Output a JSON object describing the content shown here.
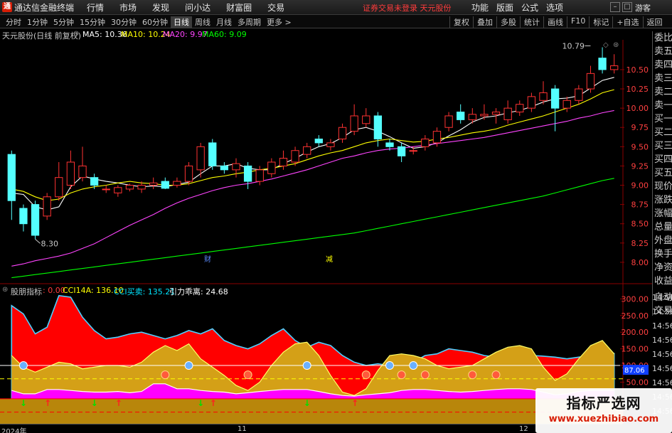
{
  "titlebar": {
    "app_title": "通达信金融终端",
    "menu": [
      "行情",
      "市场",
      "发现",
      "问小达",
      "财富圈",
      "交易"
    ],
    "login_status": "证券交易未登录  天元股份",
    "right_menu": [
      "功能",
      "版面",
      "公式",
      "选项"
    ],
    "guest": "游客"
  },
  "toolbar": {
    "periods": [
      "分时",
      "1分钟",
      "5分钟",
      "15分钟",
      "30分钟",
      "60分钟",
      "日线",
      "周线",
      "月线",
      "多周期",
      "更多 >"
    ],
    "active_period": "日线",
    "tools": [
      "复权",
      "叠加",
      "多股",
      "统计",
      "画线",
      "F10",
      "标记",
      "+自选",
      "返回"
    ]
  },
  "info": {
    "stock": "天元股份(日线 前复权)",
    "ma5": "MA5: 10.36",
    "ma10": "MA10: 10.24",
    "ma20": "MA20: 9.97",
    "ma60": "MA60: 9.09"
  },
  "indicator": {
    "name": "股朋指标",
    "val0": ": 0.00",
    "cci14a": "CCI14A: 136.10",
    "cci_trade": "CCI买卖: 135.21",
    "gravity": "引力乖离: 24.68",
    "current_label": "87.06"
  },
  "sidebar": [
    "委比",
    "卖五",
    "卖四",
    "卖三",
    "卖二",
    "卖一",
    "买一",
    "买二",
    "买三",
    "买四",
    "买五",
    "现价",
    "涨跌",
    "涨幅",
    "总量",
    "外盘",
    "换手",
    "净资",
    "收益"
  ],
  "sidebar_lower": [
    "自动",
    "交易"
  ],
  "time_axis": [
    "14:56",
    "14:56",
    "14:56",
    "14:56",
    "14:56",
    "14:56",
    "14:56",
    "14:56",
    "14:56"
  ],
  "date_axis": [
    "2024年",
    "11",
    "12"
  ],
  "watermark": {
    "title": "指标严选网",
    "url": "www.xuezhibiao.com"
  },
  "chart_data": [
    {
      "type": "candlestick",
      "title": "天元股份(日线 前复权)",
      "y_ticks": [
        10.5,
        10.25,
        10.0,
        9.75,
        9.5,
        9.25,
        9.0,
        8.75,
        8.5,
        8.25,
        8.0
      ],
      "ylim": [
        7.75,
        10.85
      ],
      "markers": [
        {
          "text": "10.79",
          "label": "high"
        },
        {
          "text": "8.30",
          "label": "low"
        },
        {
          "text": "财",
          "label": "event"
        },
        {
          "text": "减",
          "label": "event"
        }
      ],
      "candles": [
        {
          "o": 8.8,
          "c": 9.4,
          "h": 9.45,
          "l": 8.55,
          "up": false
        },
        {
          "o": 8.5,
          "c": 8.7,
          "h": 8.75,
          "l": 8.4,
          "up": false
        },
        {
          "o": 8.75,
          "c": 8.35,
          "h": 8.8,
          "l": 8.3,
          "up": false
        },
        {
          "o": 8.6,
          "c": 8.85,
          "h": 8.9,
          "l": 8.55,
          "up": true
        },
        {
          "o": 8.85,
          "c": 9.1,
          "h": 9.3,
          "l": 8.8,
          "up": true
        },
        {
          "o": 9.0,
          "c": 9.3,
          "h": 9.45,
          "l": 8.95,
          "up": true
        },
        {
          "o": 9.1,
          "c": 9.25,
          "h": 9.5,
          "l": 9.05,
          "up": true
        },
        {
          "o": 9.1,
          "c": 9.0,
          "h": 9.15,
          "l": 8.95,
          "up": false
        },
        {
          "o": 8.95,
          "c": 8.95,
          "h": 9.0,
          "l": 8.9,
          "up": true
        },
        {
          "o": 8.9,
          "c": 8.97,
          "h": 9.0,
          "l": 8.85,
          "up": true
        },
        {
          "o": 8.95,
          "c": 9.0,
          "h": 9.02,
          "l": 8.92,
          "up": true
        },
        {
          "o": 9.0,
          "c": 8.95,
          "h": 9.05,
          "l": 8.9,
          "up": true
        },
        {
          "o": 9.0,
          "c": 9.03,
          "h": 9.1,
          "l": 8.95,
          "up": true
        },
        {
          "o": 9.05,
          "c": 8.96,
          "h": 9.1,
          "l": 8.95,
          "up": false
        },
        {
          "o": 9.0,
          "c": 9.05,
          "h": 9.1,
          "l": 8.97,
          "up": true
        },
        {
          "o": 9.05,
          "c": 9.25,
          "h": 9.3,
          "l": 9.0,
          "up": true
        },
        {
          "o": 9.2,
          "c": 9.5,
          "h": 9.55,
          "l": 9.1,
          "up": true
        },
        {
          "o": 9.55,
          "c": 9.25,
          "h": 9.6,
          "l": 9.2,
          "up": false
        },
        {
          "o": 9.25,
          "c": 9.2,
          "h": 9.3,
          "l": 9.15,
          "up": false
        },
        {
          "o": 9.2,
          "c": 9.28,
          "h": 9.35,
          "l": 9.1,
          "up": true
        },
        {
          "o": 9.25,
          "c": 9.05,
          "h": 9.3,
          "l": 8.95,
          "up": false
        },
        {
          "o": 9.05,
          "c": 9.2,
          "h": 9.25,
          "l": 9.0,
          "up": true
        },
        {
          "o": 9.15,
          "c": 9.3,
          "h": 9.35,
          "l": 9.1,
          "up": true
        },
        {
          "o": 9.25,
          "c": 9.35,
          "h": 9.45,
          "l": 9.2,
          "up": true
        },
        {
          "o": 9.3,
          "c": 9.45,
          "h": 9.5,
          "l": 9.25,
          "up": true
        },
        {
          "o": 9.4,
          "c": 9.5,
          "h": 9.55,
          "l": 9.35,
          "up": true
        },
        {
          "o": 9.55,
          "c": 9.6,
          "h": 9.65,
          "l": 9.5,
          "up": false
        },
        {
          "o": 9.5,
          "c": 9.55,
          "h": 9.6,
          "l": 9.45,
          "up": true
        },
        {
          "o": 9.6,
          "c": 9.75,
          "h": 9.8,
          "l": 9.55,
          "up": true
        },
        {
          "o": 9.7,
          "c": 9.9,
          "h": 10.05,
          "l": 9.65,
          "up": true
        },
        {
          "o": 9.9,
          "c": 9.8,
          "h": 10.0,
          "l": 9.75,
          "up": true
        },
        {
          "o": 9.9,
          "c": 9.6,
          "h": 9.95,
          "l": 9.5,
          "up": false
        },
        {
          "o": 9.55,
          "c": 9.5,
          "h": 9.6,
          "l": 9.45,
          "up": false
        },
        {
          "o": 9.5,
          "c": 9.38,
          "h": 9.55,
          "l": 9.3,
          "up": false
        },
        {
          "o": 9.45,
          "c": 9.45,
          "h": 9.5,
          "l": 9.4,
          "up": true
        },
        {
          "o": 9.5,
          "c": 9.6,
          "h": 9.65,
          "l": 9.45,
          "up": true
        },
        {
          "o": 9.55,
          "c": 9.7,
          "h": 9.75,
          "l": 9.5,
          "up": true
        },
        {
          "o": 9.75,
          "c": 9.9,
          "h": 9.95,
          "l": 9.7,
          "up": true
        },
        {
          "o": 9.95,
          "c": 9.85,
          "h": 10.05,
          "l": 9.8,
          "up": false
        },
        {
          "o": 9.85,
          "c": 9.92,
          "h": 10.0,
          "l": 9.8,
          "up": true
        },
        {
          "o": 9.9,
          "c": 9.92,
          "h": 10.05,
          "l": 9.85,
          "up": true
        },
        {
          "o": 9.95,
          "c": 9.92,
          "h": 10.0,
          "l": 9.8,
          "up": true
        },
        {
          "o": 9.85,
          "c": 10.0,
          "h": 10.1,
          "l": 9.8,
          "up": true
        },
        {
          "o": 9.95,
          "c": 10.05,
          "h": 10.1,
          "l": 9.9,
          "up": true
        },
        {
          "o": 10.0,
          "c": 10.15,
          "h": 10.2,
          "l": 9.95,
          "up": true
        },
        {
          "o": 10.1,
          "c": 10.2,
          "h": 10.35,
          "l": 10.05,
          "up": true
        },
        {
          "o": 10.25,
          "c": 10.0,
          "h": 10.3,
          "l": 9.7,
          "up": false
        },
        {
          "o": 10.0,
          "c": 10.1,
          "h": 10.15,
          "l": 9.95,
          "up": true
        },
        {
          "o": 10.1,
          "c": 10.25,
          "h": 10.3,
          "l": 10.05,
          "up": true
        },
        {
          "o": 10.25,
          "c": 10.45,
          "h": 10.55,
          "l": 10.2,
          "up": true
        },
        {
          "o": 10.65,
          "c": 10.5,
          "h": 10.79,
          "l": 10.45,
          "up": false
        },
        {
          "o": 10.5,
          "c": 10.55,
          "h": 10.7,
          "l": 10.45,
          "up": true
        }
      ],
      "series": [
        {
          "name": "MA5",
          "color": "#ffffff",
          "values": [
            8.9,
            8.88,
            8.72,
            8.68,
            8.72,
            8.98,
            9.12,
            9.08,
            9.05,
            9.03,
            9.0,
            8.98,
            8.99,
            8.98,
            9.01,
            9.04,
            9.15,
            9.25,
            9.25,
            9.28,
            9.22,
            9.2,
            9.2,
            9.28,
            9.35,
            9.43,
            9.5,
            9.54,
            9.62,
            9.72,
            9.75,
            9.7,
            9.63,
            9.55,
            9.48,
            9.5,
            9.55,
            9.64,
            9.72,
            9.82,
            9.88,
            9.9,
            9.94,
            9.97,
            10.02,
            10.08,
            10.12,
            10.13,
            10.16,
            10.26,
            10.36,
            10.4
          ]
        },
        {
          "name": "MA10",
          "color": "#ffff00",
          "values": [
            8.95,
            8.92,
            8.85,
            8.8,
            8.82,
            8.9,
            8.95,
            8.98,
            9.0,
            9.03,
            9.05,
            9.03,
            9.02,
            9.0,
            9.0,
            9.02,
            9.06,
            9.1,
            9.12,
            9.15,
            9.17,
            9.2,
            9.22,
            9.25,
            9.28,
            9.33,
            9.38,
            9.42,
            9.45,
            9.5,
            9.55,
            9.58,
            9.6,
            9.58,
            9.56,
            9.57,
            9.6,
            9.62,
            9.65,
            9.68,
            9.7,
            9.73,
            9.78,
            9.82,
            9.86,
            9.9,
            9.95,
            10.0,
            10.05,
            10.12,
            10.2,
            10.24
          ]
        },
        {
          "name": "MA20",
          "color": "#ff44ff",
          "values": [
            7.95,
            7.98,
            8.02,
            8.05,
            8.08,
            8.12,
            8.18,
            8.24,
            8.32,
            8.4,
            8.48,
            8.55,
            8.62,
            8.7,
            8.77,
            8.83,
            8.88,
            8.93,
            8.97,
            9.0,
            9.02,
            9.05,
            9.08,
            9.12,
            9.16,
            9.2,
            9.25,
            9.3,
            9.35,
            9.38,
            9.42,
            9.45,
            9.47,
            9.48,
            9.5,
            9.52,
            9.54,
            9.56,
            9.58,
            9.6,
            9.62,
            9.65,
            9.68,
            9.71,
            9.74,
            9.77,
            9.8,
            9.83,
            9.87,
            9.9,
            9.94,
            9.97
          ]
        },
        {
          "name": "MA60",
          "color": "#00ff00",
          "values": [
            7.8,
            7.82,
            7.84,
            7.86,
            7.88,
            7.9,
            7.92,
            7.94,
            7.96,
            7.98,
            8.0,
            8.02,
            8.04,
            8.06,
            8.08,
            8.1,
            8.12,
            8.14,
            8.16,
            8.18,
            8.2,
            8.22,
            8.24,
            8.26,
            8.28,
            8.3,
            8.32,
            8.34,
            8.36,
            8.38,
            8.41,
            8.44,
            8.47,
            8.5,
            8.53,
            8.56,
            8.59,
            8.62,
            8.65,
            8.68,
            8.71,
            8.74,
            8.77,
            8.8,
            8.83,
            8.86,
            8.9,
            8.94,
            8.98,
            9.02,
            9.06,
            9.09
          ]
        }
      ]
    },
    {
      "type": "area",
      "title": "股朋指标",
      "y_ticks": [
        300,
        250,
        200,
        150,
        100,
        50
      ],
      "ylim": [
        -75,
        335
      ],
      "series": [
        {
          "name": "CCI14A",
          "color": "#ff0000",
          "values": [
            280,
            255,
            195,
            215,
            310,
            305,
            245,
            205,
            180,
            185,
            195,
            200,
            190,
            180,
            190,
            205,
            195,
            210,
            175,
            160,
            150,
            165,
            190,
            210,
            175,
            155,
            170,
            160,
            130,
            110,
            100,
            105,
            100,
            95,
            110,
            130,
            135,
            150,
            145,
            140,
            130,
            125,
            128,
            135,
            130,
            128,
            125,
            120,
            125,
            130,
            140,
            136
          ]
        },
        {
          "name": "CCI买卖",
          "color": "#d4a017",
          "values": [
            130,
            95,
            80,
            95,
            110,
            105,
            90,
            95,
            100,
            100,
            95,
            110,
            140,
            160,
            145,
            165,
            120,
            95,
            70,
            40,
            25,
            50,
            100,
            140,
            165,
            170,
            130,
            70,
            20,
            10,
            30,
            85,
            130,
            135,
            130,
            120,
            100,
            90,
            95,
            100,
            120,
            140,
            155,
            160,
            150,
            95,
            55,
            75,
            120,
            160,
            175,
            135
          ]
        },
        {
          "name": "引力乖离",
          "color": "#ff00ff",
          "values": [
            25,
            15,
            15,
            28,
            28,
            25,
            22,
            20,
            20,
            22,
            18,
            22,
            45,
            45,
            30,
            30,
            25,
            22,
            20,
            15,
            18,
            22,
            25,
            28,
            28,
            28,
            22,
            15,
            10,
            8,
            12,
            15,
            18,
            25,
            28,
            28,
            25,
            22,
            20,
            22,
            25,
            28,
            30,
            30,
            28,
            20,
            12,
            15,
            22,
            25,
            25,
            25
          ]
        }
      ],
      "buy_marks": [
        1,
        7,
        16,
        25
      ],
      "sell_marks": [
        3,
        9,
        17,
        29
      ],
      "balls_blue": [
        1,
        15,
        25,
        32,
        34
      ],
      "balls_red": [
        13,
        20,
        30,
        33,
        35,
        39,
        41
      ]
    }
  ]
}
